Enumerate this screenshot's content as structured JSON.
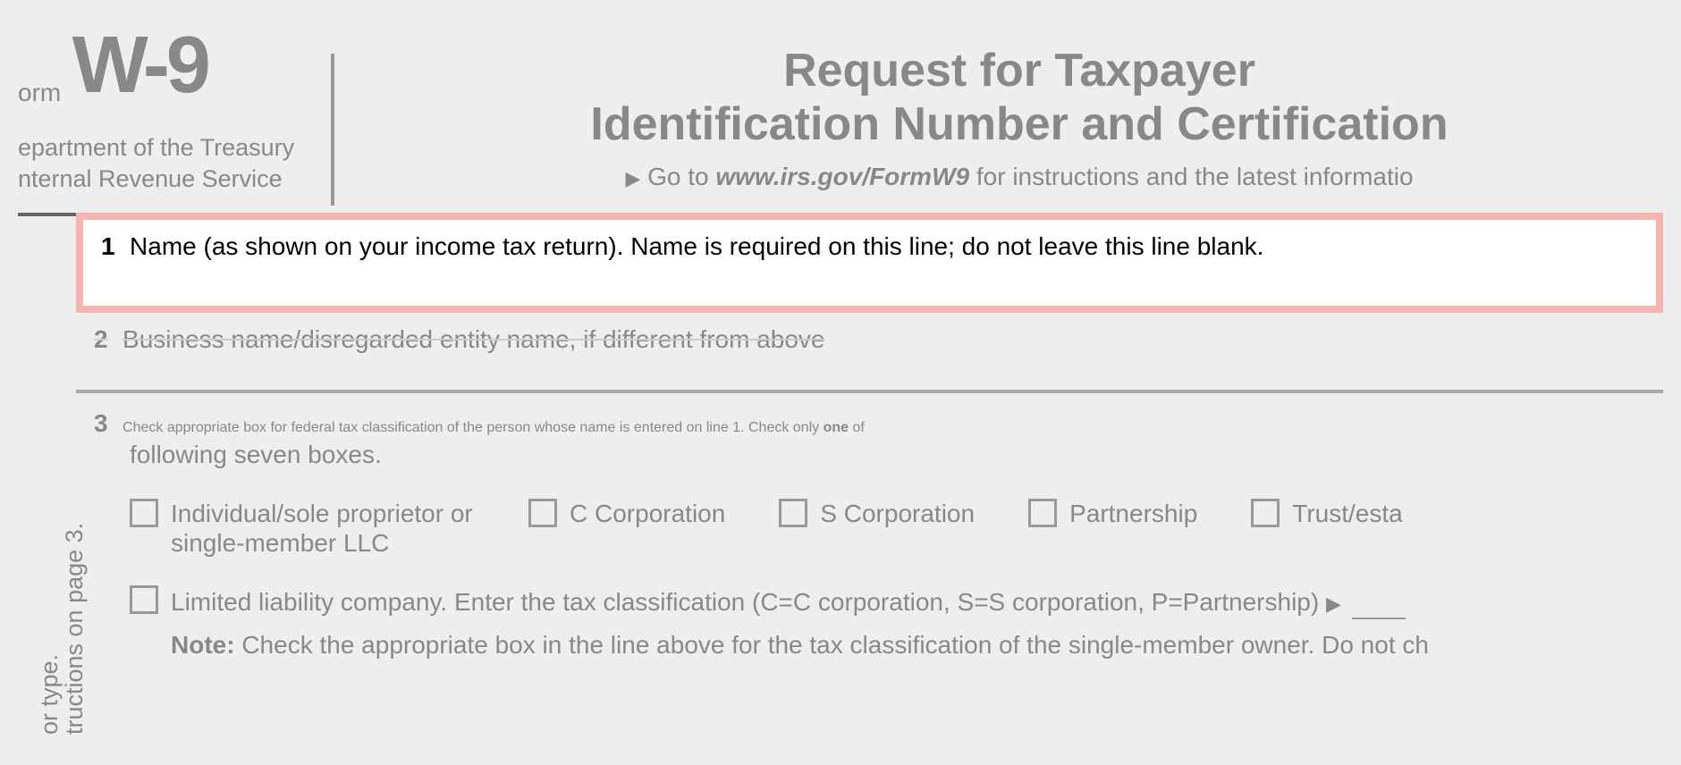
{
  "header": {
    "form_label": "orm",
    "form_code": "W-9",
    "dept_line1": "epartment of the Treasury",
    "dept_line2": "nternal Revenue Service",
    "title_line1": "Request for Taxpayer",
    "title_line2": "Identification Number and Certification",
    "goto_prefix": "Go to ",
    "goto_url": "www.irs.gov/FormW9",
    "goto_suffix": " for instructions and the latest informatio",
    "arrow": "▶"
  },
  "side": {
    "text1": "or type.",
    "text2": "tructions on page 3."
  },
  "line1": {
    "number": "1",
    "text": "Name (as shown on your income tax return). Name is required on this line; do not leave this line blank."
  },
  "line2": {
    "number": "2",
    "text": "Business name/disregarded entity name, if different from above"
  },
  "line3": {
    "number": "3",
    "text_part1": "Check appropriate box for federal tax classification of the person whose name is entered on line 1. Check only ",
    "text_strong": "one",
    "text_part2": " of",
    "text_part3": "following seven boxes."
  },
  "checkboxes": {
    "individual": "Individual/sole proprietor or single-member LLC",
    "c_corp": "C Corporation",
    "s_corp": "S Corporation",
    "partnership": "Partnership",
    "trust": "Trust/esta"
  },
  "llc": {
    "text": "Limited liability company. Enter the tax classification (C=C corporation, S=S corporation, P=Partnership)",
    "arrow": "▶",
    "note_label": "Note:",
    "note_text": " Check the appropriate box in the line above for the tax classification of the single-member owner.  Do not ch"
  }
}
